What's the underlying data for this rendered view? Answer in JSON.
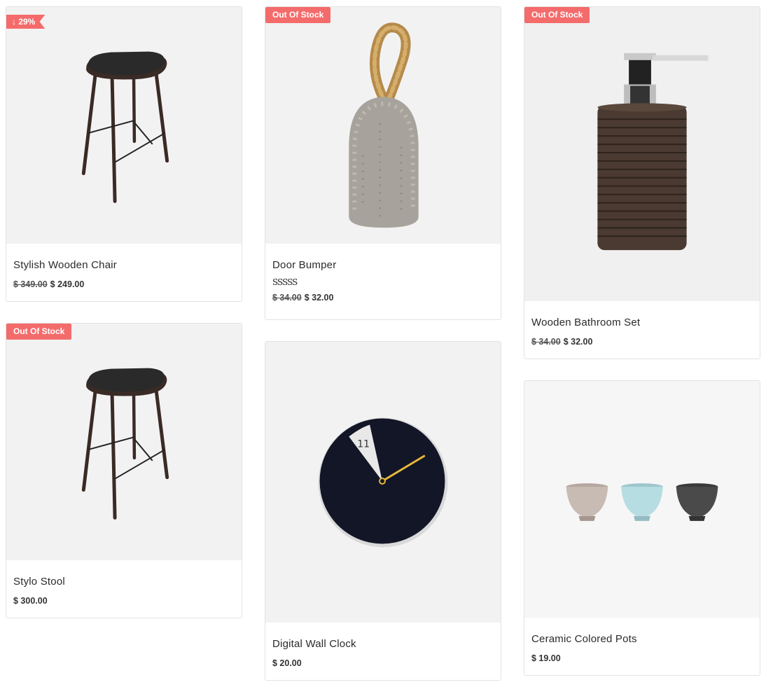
{
  "products": [
    {
      "title": "Stylish Wooden Chair",
      "old_price": "$ 349.00",
      "price": "$ 249.00",
      "badge": "↓ 29%"
    },
    {
      "title": "Door Bumper",
      "rating": "SSSSS",
      "old_price": "$ 34.00",
      "price": "$ 32.00",
      "badge": "Out Of Stock"
    },
    {
      "title": "Wooden Bathroom Set",
      "old_price": "$ 34.00",
      "price": "$ 32.00",
      "badge": "Out Of Stock"
    },
    {
      "title": "Stylo Stool",
      "price": "$ 300.00",
      "badge": "Out Of Stock"
    },
    {
      "title": "Digital Wall Clock",
      "price": "$ 20.00",
      "clock_number": "11"
    },
    {
      "title": "Ceramic Colored Pots",
      "price": "$ 19.00"
    }
  ],
  "colors": {
    "badge": "#f46b6b",
    "image_background": "#f2f2f2",
    "clock_hand": "#e7b83a"
  },
  "icons": [
    "bar-stool-image",
    "rope-door-bumper-image",
    "soap-dispenser-image",
    "clock-image",
    "ceramic-pots-image"
  ]
}
